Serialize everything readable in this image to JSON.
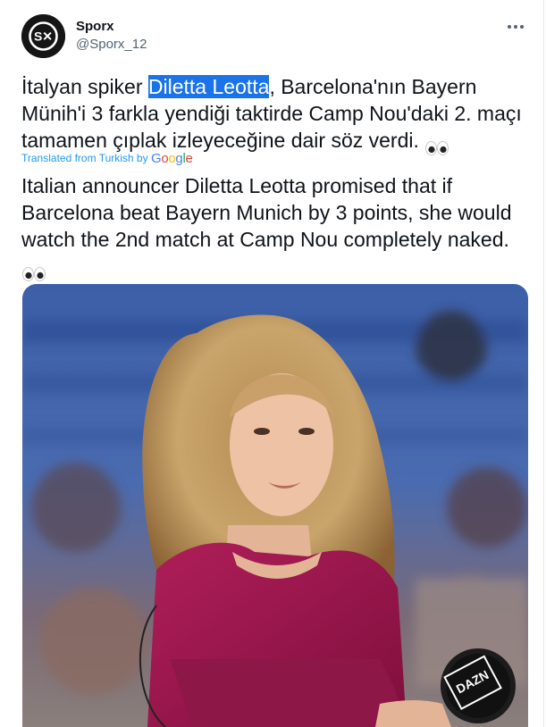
{
  "tweet": {
    "display_name": "Sporx",
    "handle": "@Sporx_12",
    "original_text_before": "İtalyan spiker ",
    "original_highlight": "Diletta Leotta",
    "original_text_after": ", Barcelona'nın Bayern Münih'i 3 farkla yendiği taktirde Camp Nou'daki 2. maçı tamamen çıplak izleyeceğine dair söz verdi.",
    "translated_from_label": "Translated from Turkish by",
    "translator_letters": [
      "G",
      "o",
      "o",
      "g",
      "l",
      "e"
    ],
    "translation_text": "Italian announcer Diletta Leotta promised that if Barcelona beat Bayern Munich by 3 points, she would watch the 2nd match at Camp Nou completely naked."
  },
  "icons": {
    "avatar": "sporx-logo-icon",
    "more": "more-horizontal-icon",
    "emoji": "eyes-emoji-icon"
  },
  "colors": {
    "highlight_bg": "#1a73e8",
    "link_blue": "#1d9bf0",
    "text_primary": "#0f1419",
    "text_secondary": "#536471",
    "google_blue": "#4285F4",
    "google_red": "#EA4335",
    "google_yellow": "#FBBC05",
    "google_green": "#34A853"
  },
  "media": {
    "microphone_brand": "DAZN"
  }
}
